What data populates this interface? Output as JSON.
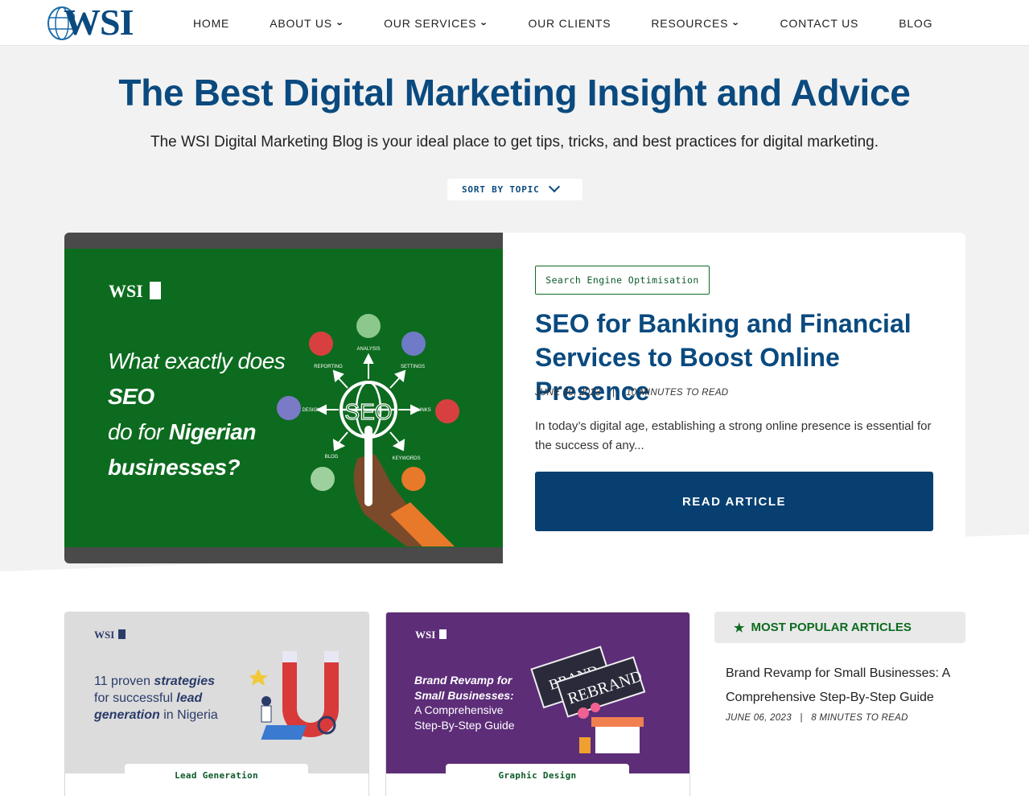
{
  "header": {
    "logo_text": "WSI",
    "nav": [
      {
        "label": "HOME",
        "dropdown": false
      },
      {
        "label": "ABOUT US",
        "dropdown": true
      },
      {
        "label": "OUR SERVICES",
        "dropdown": true
      },
      {
        "label": "OUR CLIENTS",
        "dropdown": false
      },
      {
        "label": "RESOURCES",
        "dropdown": true
      },
      {
        "label": "CONTACT US",
        "dropdown": false
      },
      {
        "label": "BLOG",
        "dropdown": false
      }
    ]
  },
  "hero": {
    "title": "The Best Digital Marketing Insight and Advice",
    "subtitle": "The WSI Digital Marketing Blog is your ideal place to get tips, tricks, and best practices for digital marketing.",
    "sort_label": "SORT BY TOPIC"
  },
  "featured": {
    "image": {
      "logo": "WSI",
      "headline_1": "What exactly does",
      "headline_2": "SEO",
      "headline_3": "do for",
      "headline_4": "Nigerian businesses?",
      "center": "SEO",
      "labels": {
        "analysis": "ANALYSIS",
        "reporting": "REPORTING",
        "settings": "SETTINGS",
        "design": "DESIGN",
        "links": "LINKS",
        "blog": "BLOG",
        "keywords": "KEYWORDS"
      }
    },
    "tag": "Search Engine Optimisation",
    "title": "SEO for Banking and Financial Services to Boost Online Presence",
    "date": "JUNE 30, 2023",
    "read_time": "10 MINUTES TO READ",
    "meta_sep": "|",
    "excerpt": "In today’s digital age, establishing a strong online presence is essential for the success of any...",
    "button": "READ ARTICLE"
  },
  "cards": [
    {
      "logo": "WSI",
      "line1_a": "11 proven ",
      "line1_b": "strategies",
      "line2_a": "for successful ",
      "line2_b": "lead",
      "line3_a": "generation",
      "line3_b": " in Nigeria",
      "tag": "Lead Generation"
    },
    {
      "logo": "WSI",
      "line1": "Brand Revamp for",
      "line2": "Small Businesses:",
      "line3": "A Comprehensive",
      "line4": "Step-By-Step Guide",
      "sign1": "BRAND",
      "sign2": "REBRAND",
      "tag": "Graphic Design"
    }
  ],
  "sidebar": {
    "heading": "MOST POPULAR ARTICLES",
    "items": [
      {
        "title": "Brand Revamp for Small Businesses: A Comprehensive Step-By-Step Guide",
        "date": "JUNE 06, 2023",
        "read_time": "8 MINUTES TO READ"
      }
    ]
  },
  "colors": {
    "primary_blue": "#0a4a7f",
    "button_blue": "#073f70",
    "green": "#0d6b1f",
    "card_purple": "#5d2d78"
  }
}
